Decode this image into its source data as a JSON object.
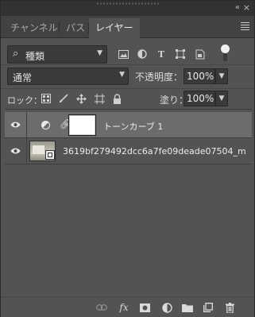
{
  "window": {
    "collapse_glyph": "«",
    "close_glyph": "×"
  },
  "tabs": [
    {
      "label": "チャンネル"
    },
    {
      "label": "パス"
    },
    {
      "label": "レイヤー"
    }
  ],
  "filter": {
    "icon": "search-icon",
    "label": "種類",
    "chevron": "⌄"
  },
  "filter_icons": [
    "pixel-layer-filter-icon",
    "adjustment-filter-icon",
    "type-filter-icon",
    "shape-filter-icon",
    "smart-object-filter-icon"
  ],
  "blend": {
    "label": "通常",
    "chevron": "⌄"
  },
  "opacity": {
    "label": "不透明度：",
    "value": "100%"
  },
  "lock": {
    "label": "ロック："
  },
  "fill": {
    "label": "塗り：",
    "value": "100%"
  },
  "layers": [
    {
      "name": "トーンカーブ 1",
      "type": "adjustment",
      "selected": true
    },
    {
      "name": "3619bf279492dcc6a7fe09deade07504_m",
      "type": "smart-object",
      "selected": false
    }
  ],
  "footer_icons": [
    "link-layers-icon",
    "fx-icon",
    "add-mask-icon",
    "adjustment-layer-icon",
    "new-group-icon",
    "new-layer-icon",
    "trash-icon"
  ],
  "colors": {
    "panel": "#535353",
    "selected_row": "#6c6c6c",
    "tabbar": "#424242"
  }
}
